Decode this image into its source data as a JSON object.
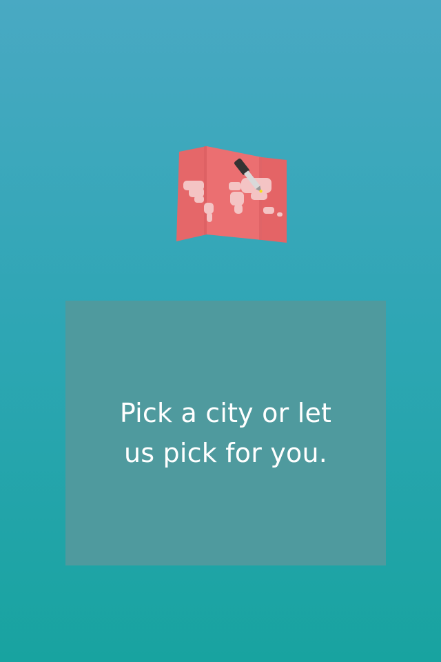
{
  "onboarding": {
    "icon": "world-map-with-pen-icon",
    "message": "Pick a city or let us pick for you."
  },
  "colors": {
    "background_top": "#49a9c3",
    "background_bottom": "#18a3a0",
    "panel": "#4f9a9e",
    "map": "#e86a6c",
    "text": "#ffffff"
  }
}
